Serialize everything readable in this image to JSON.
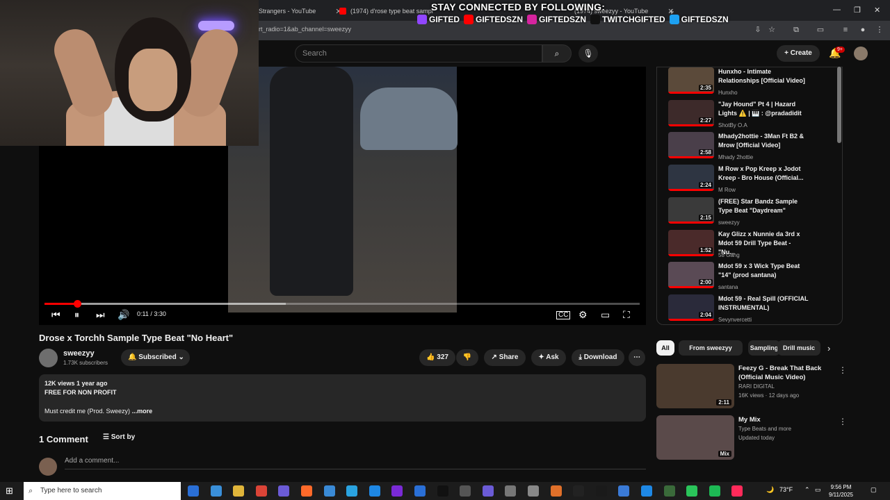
{
  "browser": {
    "tabs": [
      {
        "title": "Strangers - YouTube"
      },
      {
        "title": "(1974) d'rose type beat sampl"
      },
      {
        "title": "(1974) sweezyy - YouTube"
      }
    ],
    "url": "rt_radio=1&ab_channel=sweezyy"
  },
  "stream_overlay": {
    "title": "STAY CONNECTED BY FOLLOWING:",
    "socials": [
      {
        "platform": "twitch-icon",
        "handle": "GIFTED",
        "color": "#9146ff"
      },
      {
        "platform": "youtube-icon",
        "handle": "GIFTEDSZN",
        "color": "#ff0000"
      },
      {
        "platform": "instagram-icon",
        "handle": "GIFTEDSZN",
        "color": "#d6249f"
      },
      {
        "platform": "tiktok-icon",
        "handle": "TWITCHGIFTED",
        "color": "#111111"
      },
      {
        "platform": "twitter-icon",
        "handle": "GIFTEDSZN",
        "color": "#1da1f2"
      }
    ]
  },
  "header": {
    "search_placeholder": "Search",
    "create_label": "Create",
    "notif_badge": "9+"
  },
  "player": {
    "current_time": "0:11 / 3:30",
    "progress_fraction": 0.055,
    "buffered_fraction": 0.405
  },
  "video": {
    "title": "Drose x Torchh Sample Type Beat \"No Heart\"",
    "channel": "sweezyy",
    "subscribers": "1.73K subscribers",
    "subscribed_label": "Subscribed",
    "likes": "327",
    "share_label": "Share",
    "ask_label": "Ask",
    "download_label": "Download"
  },
  "description": {
    "meta": "12K views  1 year ago",
    "line1": "FREE FOR NON PROFIT",
    "line2": "Must credit me (Prod. Sweezy)",
    "more": "...more"
  },
  "comments": {
    "count_label": "1 Comment",
    "sort_label": "Sort by",
    "add_placeholder": "Add a comment..."
  },
  "playlist": [
    {
      "title": "Hunxho - Intimate Relationships [Official Video]",
      "channel": "Hunxho",
      "duration": "2:35"
    },
    {
      "title": "\"Jay Hound\" Pt 4 | Hazard Lights ⚠️ | 🎹 : @pradadidit",
      "channel": "ShotBy O.A",
      "duration": "2:27"
    },
    {
      "title": "Mhady2hottie - 3Man Ft B2 & Mrow [Official Video]",
      "channel": "Mhady 2hottie",
      "duration": "2:58"
    },
    {
      "title": "M Row x Pop Kreep x Jodot Kreep - Bro House (Official...",
      "channel": "M Row",
      "duration": "2:24"
    },
    {
      "title": "(FREE) Star Bandz Sample Type Beat \"Daydream\"",
      "channel": "sweezyy",
      "duration": "2:15"
    },
    {
      "title": "Kay Glizz x Nunnie da 3rd x Mdot 59 Drill Type Beat - \"Nu...",
      "channel": "58 Gang",
      "duration": "1:52"
    },
    {
      "title": "Mdot 59 x 3 Wick Type Beat \"14\" (prod santana)",
      "channel": "santana",
      "duration": "2:00"
    },
    {
      "title": "Mdot 59 - Real Spill (OFFICIAL INSTRUMENTAL)",
      "channel": "Sevynvercetti",
      "duration": "2:04"
    }
  ],
  "chips": [
    "All",
    "From sweezyy",
    "Sampling",
    "Drill music"
  ],
  "recommendations": [
    {
      "title": "Feezy G - Break That Back (Official Music Video)",
      "channel": "RARI DIGITAL",
      "meta": "16K views · 12 days ago",
      "duration": "2:11"
    },
    {
      "title": "My Mix",
      "channel": "Type Beats and more",
      "meta": "Updated today",
      "duration": "Mix"
    }
  ],
  "taskbar": {
    "search_placeholder": "Type here to search",
    "temperature": "73°F",
    "time": "9:56 PM",
    "date": "9/11/2025"
  }
}
